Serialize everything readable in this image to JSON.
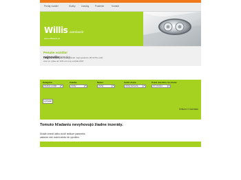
{
  "nav": {
    "items": [
      "Predaj vozidiel",
      "Služby",
      "Leasing",
      "Poistenie",
      "Kontakt"
    ]
  },
  "logo": {
    "main": "Willis",
    "sub": "autobazár",
    "url": "www.willisauto.sk"
  },
  "promo": {
    "title": "Penuke vozidla!",
    "line1": "Všetky vozidlá v našom autobazári majú garanciu 3R (STK) a EK.",
    "line2": "Auto vo výške až 10% od ceny vozidla 1997."
  },
  "search": {
    "title_bold": "najnovšie",
    "title_light": "ponuky",
    "fields": [
      {
        "label": "Kategória",
        "value": "Osobné vozidlá"
      },
      {
        "label": "Značka",
        "value": "všetky"
      },
      {
        "label": "Model",
        "value": "všetky"
      },
      {
        "label": "Zvoliť druhu",
        "value": "všetky karosérie"
      },
      {
        "label": "Počet inzerátov na stranu",
        "value": "10 inzerátov"
      }
    ],
    "submit": "vyhľadať",
    "count": "Celkom: 0 inzerátov"
  },
  "results": {
    "no_results": "Tomuto hľadaniu nevyhovujú žiadne inzeráty.",
    "hint_line1": "Skúste zmeniť alebo zrušiť niektoré parametre,",
    "hint_line2": "zadaním nich hodnôt alebo ich vynulitím."
  },
  "colors": {
    "accent_green": "#a5d121",
    "top_orange": "#f07a1a",
    "promo_title_green": "#8cc313"
  }
}
